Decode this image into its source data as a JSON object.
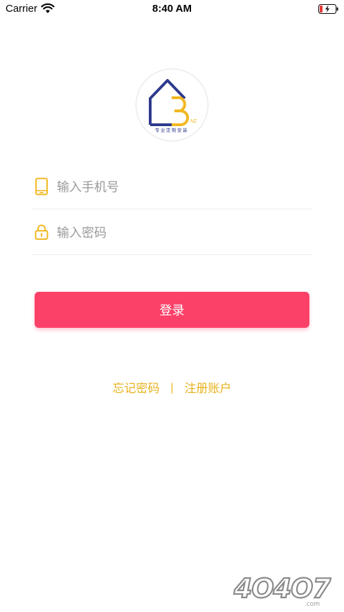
{
  "status_bar": {
    "carrier": "Carrier",
    "time": "8:40 AM",
    "icons": [
      "wifi-icon",
      "battery-icon"
    ]
  },
  "logo": {
    "letter": "B",
    "suffix": "NZ",
    "tagline": "专业定制安装",
    "colors": {
      "house": "#2d3a8c",
      "letter": "#f2b822"
    }
  },
  "login_form": {
    "phone": {
      "placeholder": "输入手机号",
      "value": "",
      "icon": "phone-icon"
    },
    "password": {
      "placeholder": "输入密码",
      "value": "",
      "icon": "lock-icon"
    },
    "submit_label": "登录"
  },
  "links": {
    "forgot_password": "忘记密码",
    "separator": "|",
    "register": "注册账户"
  },
  "watermark": {
    "text": "4O4O7",
    "suffix": ".com"
  },
  "colors": {
    "primary_button": "#fc4169",
    "link": "#e8b21e",
    "icon_accent": "#f2b822",
    "placeholder": "#9a9a9a",
    "divider": "#eeeeee"
  }
}
